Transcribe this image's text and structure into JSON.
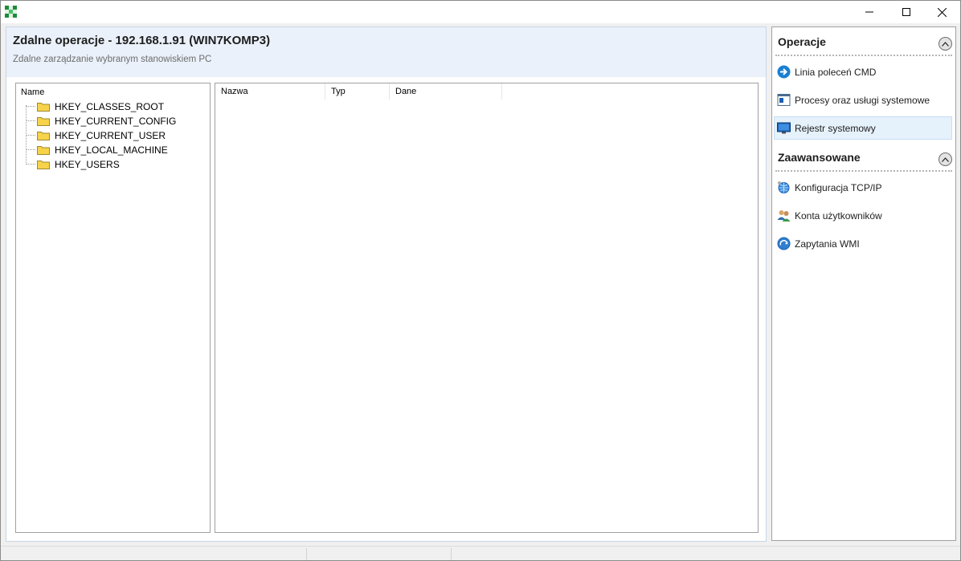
{
  "window": {
    "app_icon": "checkered-green-app-icon",
    "controls": [
      "minimize-icon",
      "maximize-icon",
      "close-icon"
    ]
  },
  "header": {
    "title": "Zdalne operacje - 192.168.1.91 (WIN7KOMP3)",
    "subtitle": "Zdalne zarządzanie wybranym stanowiskiem PC"
  },
  "tree": {
    "column": "Name",
    "items": [
      {
        "label": "HKEY_CLASSES_ROOT",
        "icon": "folder-icon"
      },
      {
        "label": "HKEY_CURRENT_CONFIG",
        "icon": "folder-icon"
      },
      {
        "label": "HKEY_CURRENT_USER",
        "icon": "folder-icon"
      },
      {
        "label": "HKEY_LOCAL_MACHINE",
        "icon": "folder-icon"
      },
      {
        "label": "HKEY_USERS",
        "icon": "folder-icon"
      }
    ]
  },
  "list": {
    "columns": [
      "Nazwa",
      "Typ",
      "Dane"
    ]
  },
  "tasks": {
    "sections": [
      {
        "title": "Operacje",
        "items": [
          {
            "label": "Linia poleceń CMD",
            "icon": "arrow-right-icon",
            "selected": false
          },
          {
            "label": "Procesy oraz usługi systemowe",
            "icon": "process-window-icon",
            "selected": false
          },
          {
            "label": "Rejestr systemowy",
            "icon": "monitor-icon",
            "selected": true
          }
        ]
      },
      {
        "title": "Zaawansowane",
        "items": [
          {
            "label": "Konfiguracja TCP/IP",
            "icon": "network-globe-icon",
            "selected": false
          },
          {
            "label": "Konta użytkowników",
            "icon": "users-icon",
            "selected": false
          },
          {
            "label": "Zapytania WMI",
            "icon": "wmi-query-icon",
            "selected": false
          }
        ]
      }
    ]
  },
  "colors": {
    "header_bg": "#eaf1fa",
    "selected_bg": "#e5f1fb",
    "accent_blue": "#1a7fd3",
    "folder_yellow": "#f7d34b"
  }
}
